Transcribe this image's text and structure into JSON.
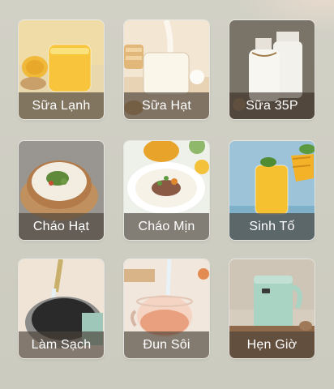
{
  "tiles": [
    {
      "label": "Sữa Lạnh",
      "icon": "cold-milk-corn-icon"
    },
    {
      "label": "Sữa Hạt",
      "icon": "nut-milk-glass-icon"
    },
    {
      "label": "Sữa 35P",
      "icon": "milk-bottles-icon"
    },
    {
      "label": "Cháo Hạt",
      "icon": "grain-porridge-bowl-icon"
    },
    {
      "label": "Cháo Mịn",
      "icon": "smooth-porridge-plate-icon"
    },
    {
      "label": "Sinh Tố",
      "icon": "mango-smoothie-icon"
    },
    {
      "label": "Làm Sạch",
      "icon": "cleaning-pitcher-icon"
    },
    {
      "label": "Đun Sôi",
      "icon": "boiling-teapot-icon"
    },
    {
      "label": "Hẹn Giờ",
      "icon": "timer-kettle-icon"
    }
  ]
}
